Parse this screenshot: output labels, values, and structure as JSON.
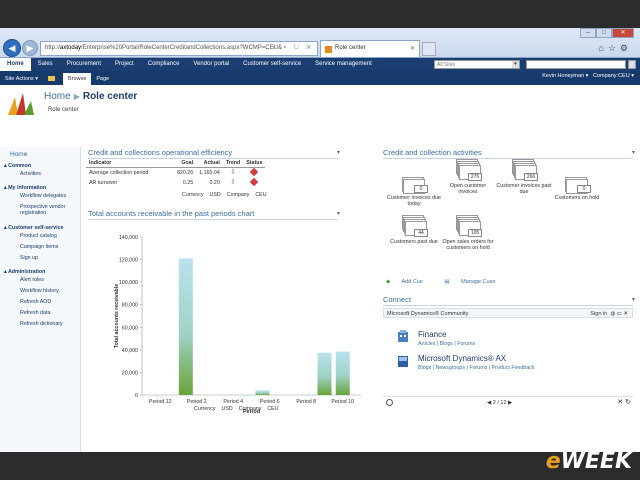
{
  "browser": {
    "address_prefix": "http://",
    "address_host": "axtoday",
    "address_path": "/Enterprise%20Portal/RoleCenterCreditandCollections.aspx?WCMP=CEU&",
    "tab_title": "Role center"
  },
  "topnav": {
    "items": [
      "Home",
      "Sales",
      "Procurement",
      "Project",
      "Compliance",
      "Vendor portal",
      "Customer self-service",
      "Service management"
    ],
    "site_select": "All Sites"
  },
  "ribbon": {
    "site_actions": "Site Actions",
    "tabs": [
      "Browse",
      "Page"
    ],
    "user": "Kevin Honeyman",
    "company": "Company:CEU"
  },
  "header": {
    "crumb_home": "Home",
    "crumb_current": "Role center",
    "subtitle": "Role center"
  },
  "leftnav": {
    "home": "Home",
    "sections": [
      {
        "title": "Common",
        "items": [
          "Activities"
        ]
      },
      {
        "title": "My information",
        "items": [
          "Workflow delegates",
          "Prospective vendor registration"
        ]
      },
      {
        "title": "Customer self-service",
        "items": [
          "Product catalog",
          "Campaign items",
          "Sign up"
        ]
      },
      {
        "title": "Administration",
        "items": [
          "Alert rules",
          "Workflow history",
          "Refresh AOD",
          "Refresh data",
          "Refresh dictionary"
        ]
      }
    ]
  },
  "kpi": {
    "title": "Credit and collections operational efficiency",
    "headers": [
      "Indicator",
      "Goal",
      "Actual",
      "Trend",
      "Status"
    ],
    "rows": [
      {
        "indicator": "Average collection period",
        "goal": "820.26",
        "actual": "1,165.04"
      },
      {
        "indicator": "AR turnover",
        "goal": "0.25",
        "actual": "0.20"
      }
    ],
    "footer": [
      "Currency",
      "USD",
      "Company",
      "CEU"
    ]
  },
  "chart_panel": {
    "title": "Total accounts receivable in the past periods chart",
    "footer": [
      "Currency",
      "USD",
      "Company",
      "CEU"
    ]
  },
  "chart_data": {
    "type": "bar",
    "categories": [
      "Period 12",
      "Period 2",
      "Period 4",
      "Period 6",
      "Period 8",
      "Period 10"
    ],
    "tick_categories": [
      "Period 12",
      "Period 2",
      "Period 4",
      "Period 6",
      "Period 8",
      "Period 10"
    ],
    "values": [
      0,
      121000,
      0,
      4000,
      0,
      37500,
      38500
    ],
    "bars": [
      {
        "slot": 0.5,
        "value": 0
      },
      {
        "slot": 1.2,
        "value": 121000
      },
      {
        "slot": 2.9,
        "value": 0
      },
      {
        "slot": 3.3,
        "value": 4000
      },
      {
        "slot": 4.6,
        "value": 0
      },
      {
        "slot": 5.0,
        "value": 37500
      },
      {
        "slot": 5.5,
        "value": 38500
      }
    ],
    "xlabel": "Period",
    "ylabel": "Total accounts receivable",
    "ylim": [
      0,
      140000
    ],
    "yticks": [
      "0",
      "20,000",
      "40,000",
      "60,000",
      "80,000",
      "100,000",
      "120,000",
      "140,000"
    ],
    "bar_color_top": "#b9e2ec",
    "bar_color_bottom": "#6aa33a"
  },
  "activities": {
    "title": "Credit and collection activities",
    "cues": [
      {
        "count": "0",
        "label": "Customer invoices due today"
      },
      {
        "count": "276",
        "label": "Open customer invoices"
      },
      {
        "count": "266",
        "label": "Customer invoices past due"
      },
      {
        "count": "0",
        "label": "Customers on hold"
      },
      {
        "count": "44",
        "label": "Customers past due"
      },
      {
        "count": "105",
        "label": "Open sales orders for customers on hold"
      }
    ],
    "add_cue": "Add Cue",
    "manage_cues": "Manage Cues"
  },
  "connect": {
    "title": "Connect",
    "community": "Microsoft Dynamics® Community",
    "signin": "Sign in",
    "feeds": [
      {
        "title": "Finance",
        "links": "Articles | Blogs | Forums"
      },
      {
        "title": "Microsoft Dynamics® AX",
        "links": "Blogs | Newsgroups | Forums | Product Feedback"
      }
    ],
    "pager": "2 / 12"
  },
  "watermark": {
    "e": "e",
    "rest": "WEEK"
  },
  "colors": {
    "nav_dark": "#1b3e72",
    "link": "#3a6ea5",
    "status_red": "#d43b3b"
  }
}
